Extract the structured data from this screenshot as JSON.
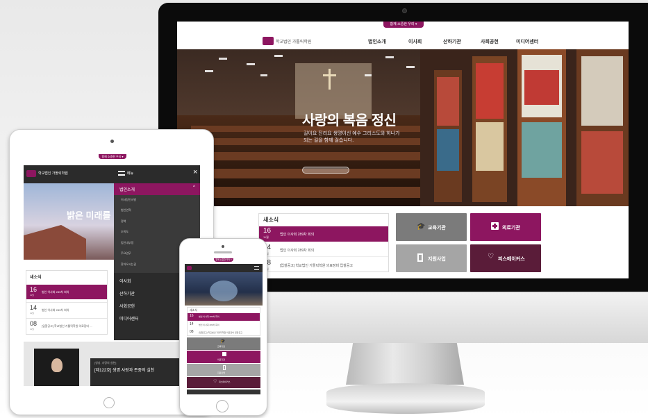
{
  "top_badge": "함께 소중한 우리 ▾",
  "site": {
    "logo_text": "학교법인 가톨릭학원",
    "nav": [
      "법인소개",
      "이사회",
      "산하기관",
      "사회공헌",
      "미디어센터"
    ]
  },
  "hero": {
    "title": "사랑의 복음 정신",
    "sub_line1": "길이요 진리요 생명이신 예수 그리스도와 하나가",
    "sub_line2": "되는 길을 함께 걸습니다."
  },
  "news": {
    "title": "새소식",
    "items": [
      {
        "day": "16",
        "month": "11월",
        "text": "법인 이사회 289차 회의"
      },
      {
        "day": "14",
        "month": "11월",
        "text": "법인 이사회 289차 회의"
      },
      {
        "day": "08",
        "month": "11월",
        "text": "[입찰공고] 학교법인 가톨릭학원 의료장비 입찰공고"
      }
    ]
  },
  "tiles": [
    {
      "label": "교육기관",
      "icon": "graduation-cap-icon",
      "color": "#7b7b7b"
    },
    {
      "label": "의료기관",
      "icon": "medical-cross-icon",
      "color": "#8d1660"
    },
    {
      "label": "지원사업",
      "icon": "building-icon",
      "color": "#a5a5a5"
    },
    {
      "label": "피스메이커스",
      "icon": "heart-hands-icon",
      "color": "#5a1c39"
    }
  ],
  "tablet": {
    "hero_title": "밝은 미래를",
    "menu_title": "메뉴",
    "menu_section": "법인소개",
    "menu_sub": [
      "이사장인사말",
      "법인연혁",
      "정책",
      "조직도",
      "법인내부망",
      "주요업무",
      "찾아오시는길"
    ],
    "menu_main": [
      "이사회",
      "산하기관",
      "사회공헌",
      "미디어센터"
    ],
    "news_items": [
      {
        "day": "16",
        "month": "11월",
        "text": "법인 이사회 289차 회의"
      },
      {
        "day": "14",
        "month": "11월",
        "text": "법인 이사회 289차 회의"
      },
      {
        "day": "08",
        "month": "11월",
        "text": "[입찰공고] 학교법인 가톨릭학원 의료장비 ..."
      }
    ],
    "video_tag": "[영성, 사랑의 실천]",
    "video_title": "[제122호] 생명 사랑과 존중의 실천"
  },
  "colors": {
    "brand": "#8d1660",
    "dark": "#2b2b2b",
    "grey": "#7b7b7b"
  }
}
